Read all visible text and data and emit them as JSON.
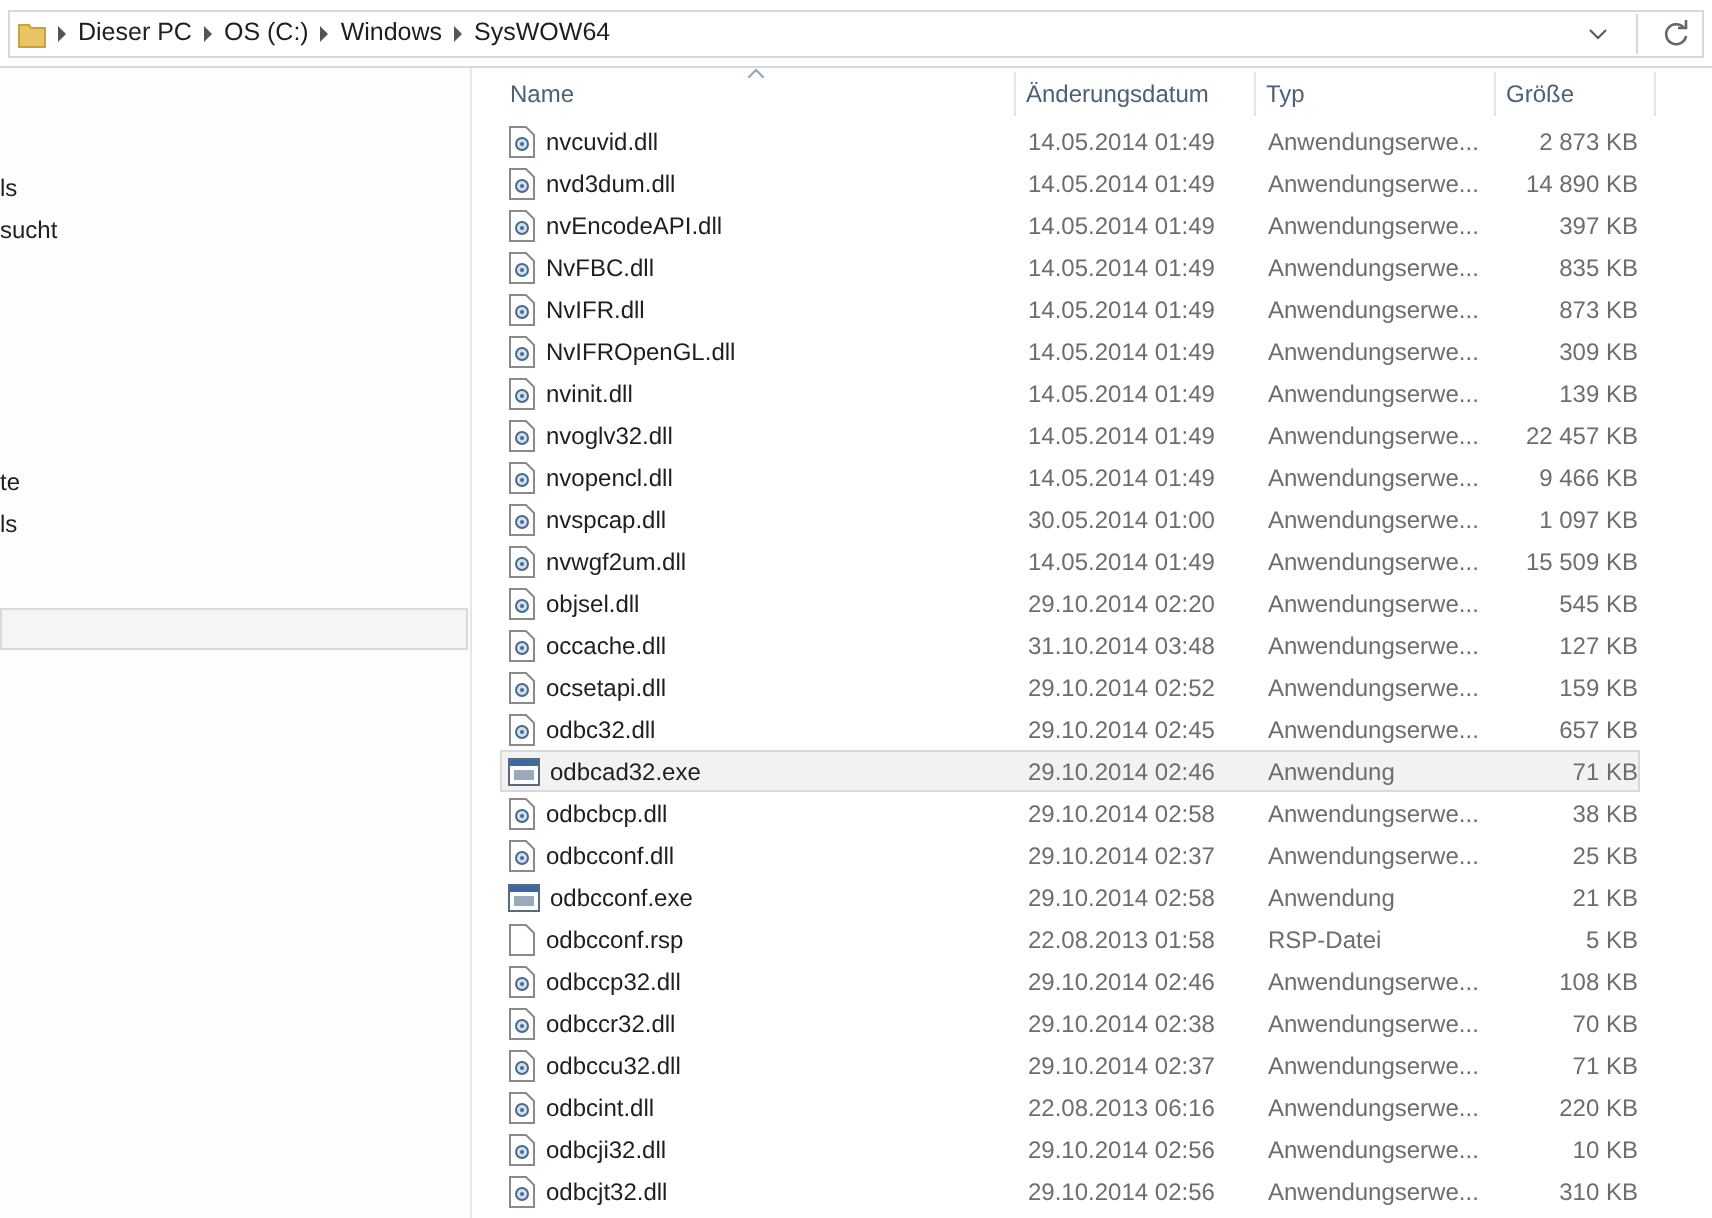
{
  "address_bar": {
    "crumbs": [
      "Dieser PC",
      "OS (C:)",
      "Windows",
      "SysWOW64"
    ]
  },
  "sidebar": {
    "items": [
      {
        "label": "ls"
      },
      {
        "label": "sucht"
      },
      {
        "label": "te"
      },
      {
        "label": "ls"
      },
      {
        "selected": true
      }
    ]
  },
  "table": {
    "columns": [
      "Name",
      "Änderungsdatum",
      "Typ",
      "Größe"
    ],
    "rows": [
      {
        "name": "nvcuvid.dll",
        "date": "14.05.2014 01:49",
        "type": "Anwendungserwe...",
        "size": "2 873 KB",
        "kind": "dll",
        "selected": false
      },
      {
        "name": "nvd3dum.dll",
        "date": "14.05.2014 01:49",
        "type": "Anwendungserwe...",
        "size": "14 890 KB",
        "kind": "dll",
        "selected": false
      },
      {
        "name": "nvEncodeAPI.dll",
        "date": "14.05.2014 01:49",
        "type": "Anwendungserwe...",
        "size": "397 KB",
        "kind": "dll",
        "selected": false
      },
      {
        "name": "NvFBC.dll",
        "date": "14.05.2014 01:49",
        "type": "Anwendungserwe...",
        "size": "835 KB",
        "kind": "dll",
        "selected": false
      },
      {
        "name": "NvIFR.dll",
        "date": "14.05.2014 01:49",
        "type": "Anwendungserwe...",
        "size": "873 KB",
        "kind": "dll",
        "selected": false
      },
      {
        "name": "NvIFROpenGL.dll",
        "date": "14.05.2014 01:49",
        "type": "Anwendungserwe...",
        "size": "309 KB",
        "kind": "dll",
        "selected": false
      },
      {
        "name": "nvinit.dll",
        "date": "14.05.2014 01:49",
        "type": "Anwendungserwe...",
        "size": "139 KB",
        "kind": "dll",
        "selected": false
      },
      {
        "name": "nvoglv32.dll",
        "date": "14.05.2014 01:49",
        "type": "Anwendungserwe...",
        "size": "22 457 KB",
        "kind": "dll",
        "selected": false
      },
      {
        "name": "nvopencl.dll",
        "date": "14.05.2014 01:49",
        "type": "Anwendungserwe...",
        "size": "9 466 KB",
        "kind": "dll",
        "selected": false
      },
      {
        "name": "nvspcap.dll",
        "date": "30.05.2014 01:00",
        "type": "Anwendungserwe...",
        "size": "1 097 KB",
        "kind": "dll",
        "selected": false
      },
      {
        "name": "nvwgf2um.dll",
        "date": "14.05.2014 01:49",
        "type": "Anwendungserwe...",
        "size": "15 509 KB",
        "kind": "dll",
        "selected": false
      },
      {
        "name": "objsel.dll",
        "date": "29.10.2014 02:20",
        "type": "Anwendungserwe...",
        "size": "545 KB",
        "kind": "dll",
        "selected": false
      },
      {
        "name": "occache.dll",
        "date": "31.10.2014 03:48",
        "type": "Anwendungserwe...",
        "size": "127 KB",
        "kind": "dll",
        "selected": false
      },
      {
        "name": "ocsetapi.dll",
        "date": "29.10.2014 02:52",
        "type": "Anwendungserwe...",
        "size": "159 KB",
        "kind": "dll",
        "selected": false
      },
      {
        "name": "odbc32.dll",
        "date": "29.10.2014 02:45",
        "type": "Anwendungserwe...",
        "size": "657 KB",
        "kind": "dll",
        "selected": false
      },
      {
        "name": "odbcad32.exe",
        "date": "29.10.2014 02:46",
        "type": "Anwendung",
        "size": "71 KB",
        "kind": "exe",
        "selected": true
      },
      {
        "name": "odbcbcp.dll",
        "date": "29.10.2014 02:58",
        "type": "Anwendungserwe...",
        "size": "38 KB",
        "kind": "dll",
        "selected": false
      },
      {
        "name": "odbcconf.dll",
        "date": "29.10.2014 02:37",
        "type": "Anwendungserwe...",
        "size": "25 KB",
        "kind": "dll",
        "selected": false
      },
      {
        "name": "odbcconf.exe",
        "date": "29.10.2014 02:58",
        "type": "Anwendung",
        "size": "21 KB",
        "kind": "exe",
        "selected": false
      },
      {
        "name": "odbcconf.rsp",
        "date": "22.08.2013 01:58",
        "type": "RSP-Datei",
        "size": "5 KB",
        "kind": "file",
        "selected": false
      },
      {
        "name": "odbccp32.dll",
        "date": "29.10.2014 02:46",
        "type": "Anwendungserwe...",
        "size": "108 KB",
        "kind": "dll",
        "selected": false
      },
      {
        "name": "odbccr32.dll",
        "date": "29.10.2014 02:38",
        "type": "Anwendungserwe...",
        "size": "70 KB",
        "kind": "dll",
        "selected": false
      },
      {
        "name": "odbccu32.dll",
        "date": "29.10.2014 02:37",
        "type": "Anwendungserwe...",
        "size": "71 KB",
        "kind": "dll",
        "selected": false
      },
      {
        "name": "odbcint.dll",
        "date": "22.08.2013 06:16",
        "type": "Anwendungserwe...",
        "size": "220 KB",
        "kind": "dll",
        "selected": false
      },
      {
        "name": "odbcji32.dll",
        "date": "29.10.2014 02:56",
        "type": "Anwendungserwe...",
        "size": "10 KB",
        "kind": "dll",
        "selected": false
      },
      {
        "name": "odbcjt32.dll",
        "date": "29.10.2014 02:56",
        "type": "Anwendungserwe...",
        "size": "310 KB",
        "kind": "dll",
        "selected": false
      }
    ]
  }
}
